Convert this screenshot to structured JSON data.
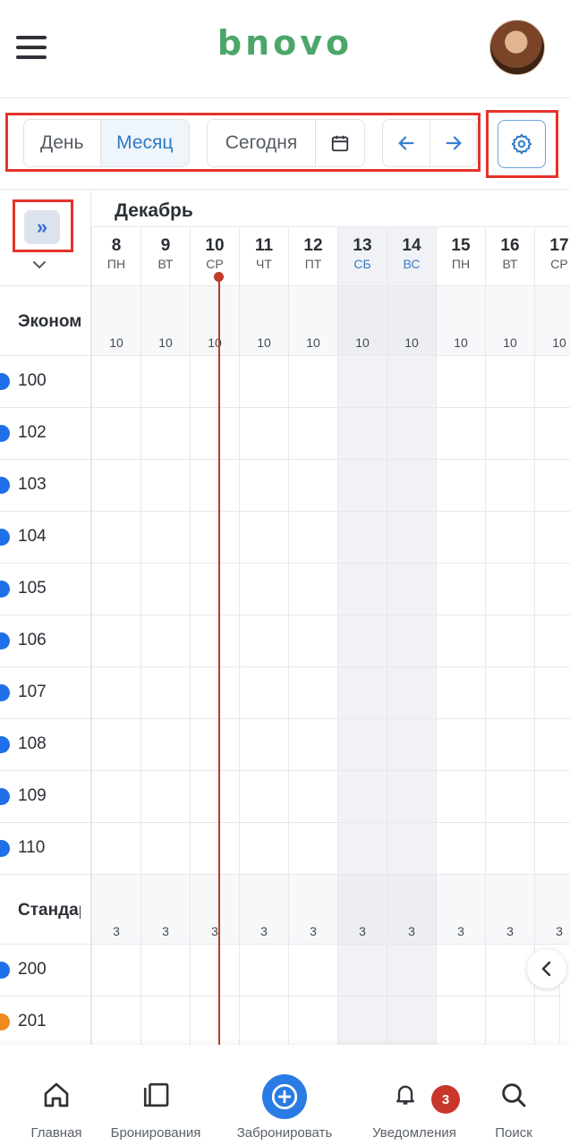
{
  "header": {
    "brand": "bnovo",
    "menu_icon": "hamburger-icon",
    "avatar_icon": "user-avatar"
  },
  "toolbar": {
    "view_day": "День",
    "view_month": "Месяц",
    "active_view": "Месяц",
    "today": "Сегодня",
    "calendar_icon": "calendar-icon",
    "prev_icon": "arrow-left-icon",
    "next_icon": "arrow-right-icon",
    "settings_icon": "gear-icon"
  },
  "calendar": {
    "month": "Декабрь",
    "expand_label": "»",
    "days": [
      {
        "num": "8",
        "dow": "ПН",
        "weekend": false
      },
      {
        "num": "9",
        "dow": "ВТ",
        "weekend": false
      },
      {
        "num": "10",
        "dow": "СР",
        "weekend": false,
        "today": true
      },
      {
        "num": "11",
        "dow": "ЧТ",
        "weekend": false
      },
      {
        "num": "12",
        "dow": "ПТ",
        "weekend": false
      },
      {
        "num": "13",
        "dow": "СБ",
        "weekend": true
      },
      {
        "num": "14",
        "dow": "ВС",
        "weekend": true
      },
      {
        "num": "15",
        "dow": "ПН",
        "weekend": false
      },
      {
        "num": "16",
        "dow": "ВТ",
        "weekend": false
      },
      {
        "num": "17",
        "dow": "СР",
        "weekend": false
      }
    ],
    "categories": [
      {
        "name": "Эконом",
        "availability": [
          "10",
          "10",
          "10",
          "10",
          "10",
          "10",
          "10",
          "10",
          "10",
          "10"
        ],
        "rooms": [
          {
            "number": "100",
            "color": "#1e6fe8"
          },
          {
            "number": "102",
            "color": "#1e6fe8"
          },
          {
            "number": "103",
            "color": "#1e6fe8"
          },
          {
            "number": "104",
            "color": "#1e6fe8"
          },
          {
            "number": "105",
            "color": "#1e6fe8"
          },
          {
            "number": "106",
            "color": "#1e6fe8"
          },
          {
            "number": "107",
            "color": "#1e6fe8"
          },
          {
            "number": "108",
            "color": "#1e6fe8"
          },
          {
            "number": "109",
            "color": "#1e6fe8"
          },
          {
            "number": "110",
            "color": "#1e6fe8"
          }
        ]
      },
      {
        "name": "Стандарт",
        "availability": [
          "3",
          "3",
          "3",
          "3",
          "3",
          "3",
          "3",
          "3",
          "3",
          "3"
        ],
        "rooms": [
          {
            "number": "200",
            "color": "#1e6fe8"
          },
          {
            "number": "201",
            "color": "#f28a1e"
          }
        ]
      }
    ]
  },
  "bottom_nav": {
    "items": [
      {
        "label": "Главная",
        "icon": "home-icon"
      },
      {
        "label": "Бронирования",
        "icon": "bookings-icon"
      },
      {
        "label": "Забронировать",
        "icon": "plus-circle-icon"
      },
      {
        "label": "Уведомления",
        "icon": "bell-icon"
      },
      {
        "label": "Поиск",
        "icon": "search-icon"
      }
    ],
    "notifications_badge": "3"
  },
  "colors": {
    "brand": "#4ca66a",
    "accent": "#2a7be4",
    "highlight": "#e5332a",
    "today_line": "#c0392b"
  }
}
